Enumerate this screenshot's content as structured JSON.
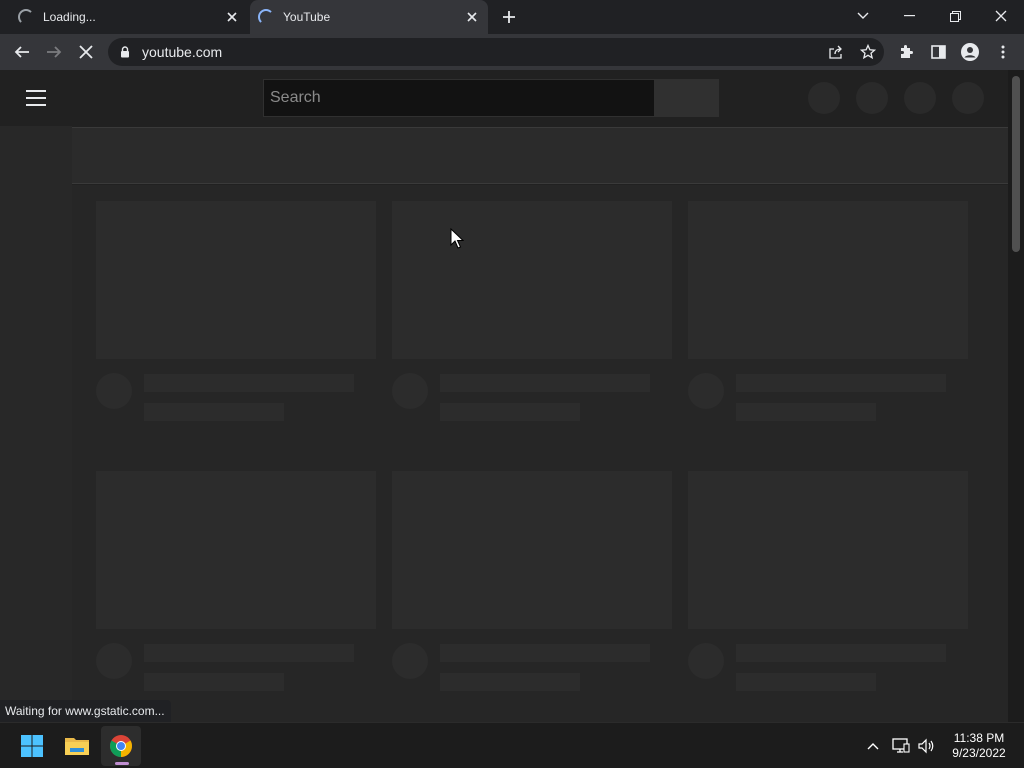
{
  "browser": {
    "tabs": [
      {
        "title": "Loading..."
      },
      {
        "title": "YouTube"
      }
    ],
    "address_bar": {
      "url": "youtube.com"
    },
    "status_text": "Waiting for www.gstatic.com..."
  },
  "youtube": {
    "search": {
      "placeholder": "Search"
    }
  },
  "taskbar": {
    "time": "11:38 PM",
    "date": "9/23/2022"
  },
  "colors": {
    "tab_spinner_active": "#8ab4f8",
    "chrome_indicator": "#c08fd1"
  }
}
